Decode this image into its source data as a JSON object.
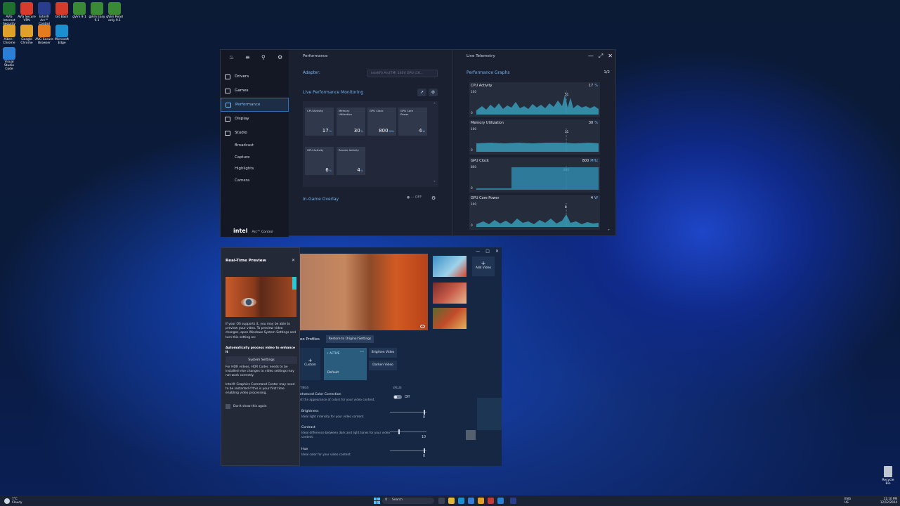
{
  "desktop": {
    "icons": [
      {
        "label": "AVG Internet\nSecurity",
        "color": "#1f6f2e"
      },
      {
        "label": "AVG Secure\nVPN",
        "color": "#d83b2b"
      },
      {
        "label": "Intel® Arc™\nControl",
        "color": "#2a3c8c"
      },
      {
        "label": "Git Bash",
        "color": "#d33c2a"
      },
      {
        "label": "gVim 9.1",
        "color": "#3a8a35"
      },
      {
        "label": "gVim Easy\n9.1",
        "color": "#3a8a35"
      },
      {
        "label": "gVim Read\nonly 9.1",
        "color": "#3a8a35"
      },
      {
        "label": "Aiken -\nChrome",
        "color": "#e0a12b"
      },
      {
        "label": "Google\nChrome",
        "color": "#e0a12b"
      },
      {
        "label": "AVG Secure\nBrowser",
        "color": "#e57b1f"
      },
      {
        "label": "Microsoft\nEdge",
        "color": "#1c8fd0"
      },
      {
        "label": "Visual Studio\nCode",
        "color": "#2b7fd6"
      }
    ],
    "recycle_bin": "Recycle Bin"
  },
  "arc": {
    "nav": [
      {
        "label": "Drivers",
        "icon": "download-icon"
      },
      {
        "label": "Games",
        "icon": "gamepad-icon"
      },
      {
        "label": "Performance",
        "icon": "gauge-icon",
        "active": true
      },
      {
        "label": "Display",
        "icon": "monitor-icon"
      },
      {
        "label": "Studio",
        "icon": "camera-icon"
      }
    ],
    "subnav": [
      "Broadcast",
      "Capture",
      "Highlights",
      "Camera"
    ],
    "brand": "intel",
    "brand_product": "Arc™ Control",
    "section_title": "Performance",
    "adapter_label": "Adapter:",
    "adapter_value": "Intel(R) Arc(TM) 140V GPU (16...",
    "lpm_title": "Live Performance Monitoring",
    "tiles": [
      {
        "label": "CPU Activity",
        "value": "17",
        "unit": "%"
      },
      {
        "label": "Memory\nUtilization",
        "value": "30",
        "unit": "%"
      },
      {
        "label": "GPU Clock",
        "value": "800",
        "unit": "MHz"
      },
      {
        "label": "GPU Core\nPower",
        "value": "4",
        "unit": "W"
      },
      {
        "label": "GPU Activity",
        "value": "6",
        "unit": "%"
      },
      {
        "label": "Render Activity",
        "value": "4",
        "unit": "%"
      }
    ],
    "overlay_label": "In-Game Overlay",
    "overlay_state": "OFF",
    "telemetry_title": "Live Telemetry",
    "graphs_title": "Performance Graphs",
    "graphs_page": "1/2",
    "graphs": [
      {
        "title": "CPU Activity",
        "value": "17",
        "unit": "%",
        "max": "100",
        "min": "0",
        "marker": "51"
      },
      {
        "title": "Memory Utilization",
        "value": "30",
        "unit": "%",
        "max": "100",
        "min": "0",
        "marker": "31"
      },
      {
        "title": "GPU Clock",
        "value": "800",
        "unit": "MHz",
        "max": "800",
        "min": "0",
        "marker": "800"
      },
      {
        "title": "GPU Core Power",
        "value": "4",
        "unit": "W",
        "max": "100",
        "min": "0",
        "marker": "8"
      }
    ]
  },
  "rtp": {
    "title": "Real-Time Preview",
    "para1": "If your OS supports it, you may be able to preview your video. To preview video changes, open Windows System Settings and turn this setting on:",
    "bold": "Automatically process video to enhance it",
    "button": "System Settings",
    "para2": "For HDR videos, HDR Codec needs to be installed else changes to video settings may not work correctly.",
    "para3": "Intel® Graphics Command Center may need to be restarted if this is your first time enabling video processing.",
    "checkbox": "Don't show this again"
  },
  "video": {
    "add_video": "Add Video",
    "profiles_label": "eo Profiles",
    "restore_btn": "Restore to Original Settings",
    "custom": "Custom",
    "active_badge": "ACTIVE",
    "default": "Default",
    "brighten": "Brighten Video",
    "darken": "Darken Video",
    "col_settings": "TINGS",
    "col_value": "VALUE",
    "settings": [
      {
        "name": "nhanced Color Correction",
        "desc": "st the appearance of colors for your video content.",
        "value": "Off"
      },
      {
        "name": "Brightness",
        "desc": "Ideal light intensity for your video content.",
        "value": "0"
      },
      {
        "name": "Contrast",
        "desc": "Ideal difference between dark and light tones for your video content.",
        "value": "10"
      },
      {
        "name": "Hue",
        "desc": "Ideal color for your video content.",
        "value": "0"
      }
    ]
  },
  "taskbar": {
    "weather_temp": "7°C",
    "weather_desc": "Cloudy",
    "search": "Search",
    "lang1": "ENG",
    "lang2": "US",
    "time": "11:10 PM",
    "date": "12/12/2024"
  }
}
